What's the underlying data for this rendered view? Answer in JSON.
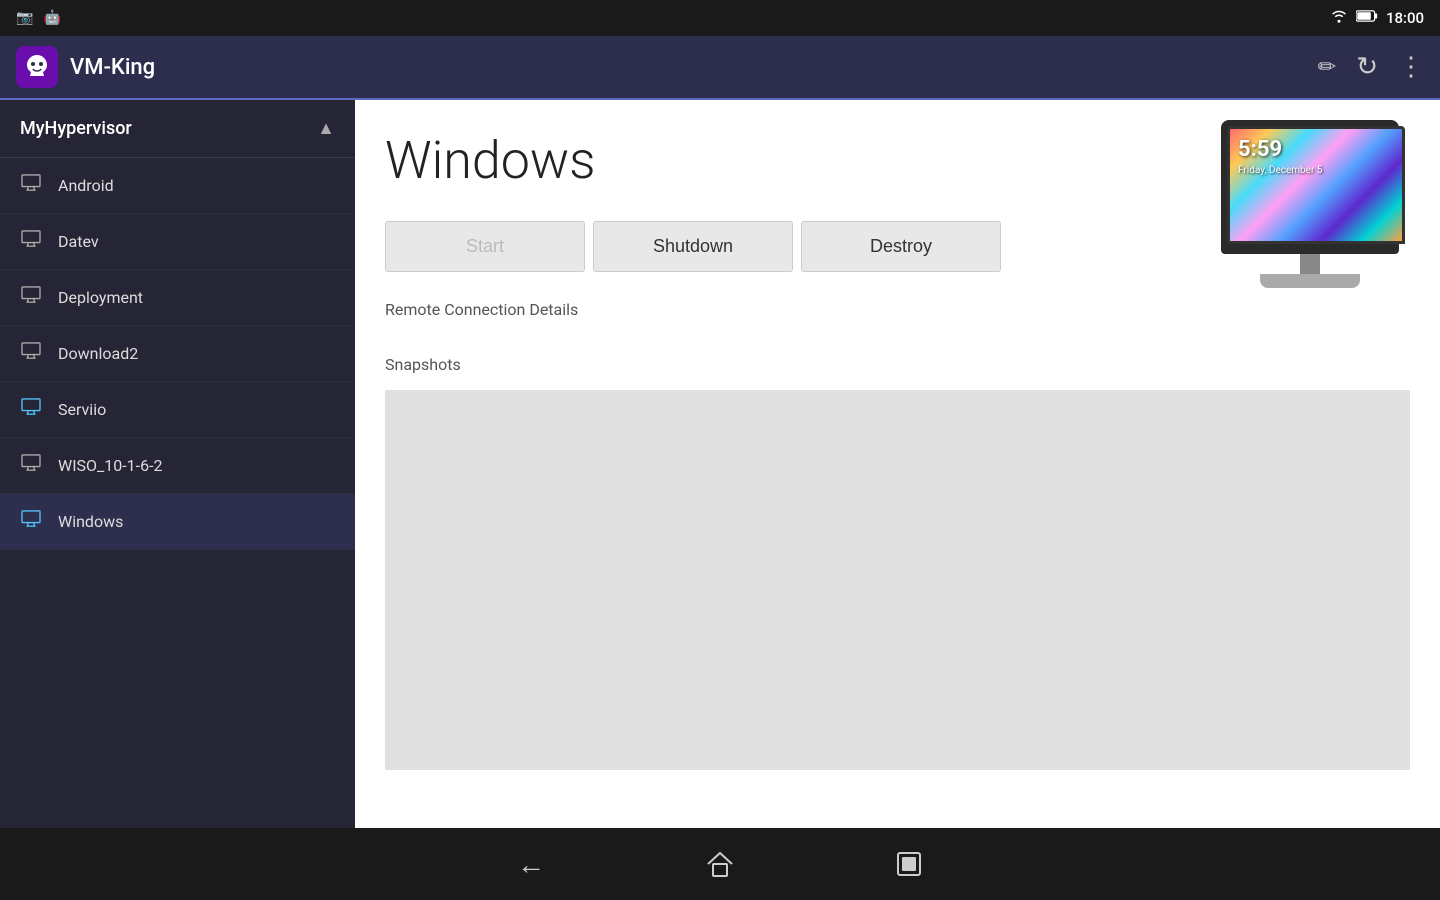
{
  "statusBar": {
    "time": "18:00",
    "batteryIcon": "🔋",
    "wifiIcon": "📶"
  },
  "appBar": {
    "title": "VM-King",
    "editIcon": "✏",
    "refreshIcon": "↻",
    "moreIcon": "⋮"
  },
  "sidebar": {
    "hypervisorName": "MyHypervisor",
    "collapseIcon": "^",
    "items": [
      {
        "label": "Android",
        "iconColor": "default"
      },
      {
        "label": "Datev",
        "iconColor": "default"
      },
      {
        "label": "Deployment",
        "iconColor": "default"
      },
      {
        "label": "Download2",
        "iconColor": "default"
      },
      {
        "label": "Serviio",
        "iconColor": "blue"
      },
      {
        "label": "WISO_10-1-6-2",
        "iconColor": "default"
      },
      {
        "label": "Windows",
        "iconColor": "blue"
      }
    ]
  },
  "content": {
    "vmName": "Windows",
    "buttons": {
      "start": "Start",
      "shutdown": "Shutdown",
      "destroy": "Destroy"
    },
    "remoteConnectionLabel": "Remote Connection Details",
    "snapshotsLabel": "Snapshots"
  },
  "monitor": {
    "time": "5:59",
    "date": "Friday, December 5"
  },
  "bottomNav": {
    "backIcon": "←",
    "homeIcon": "⌂",
    "recentIcon": "▣"
  }
}
